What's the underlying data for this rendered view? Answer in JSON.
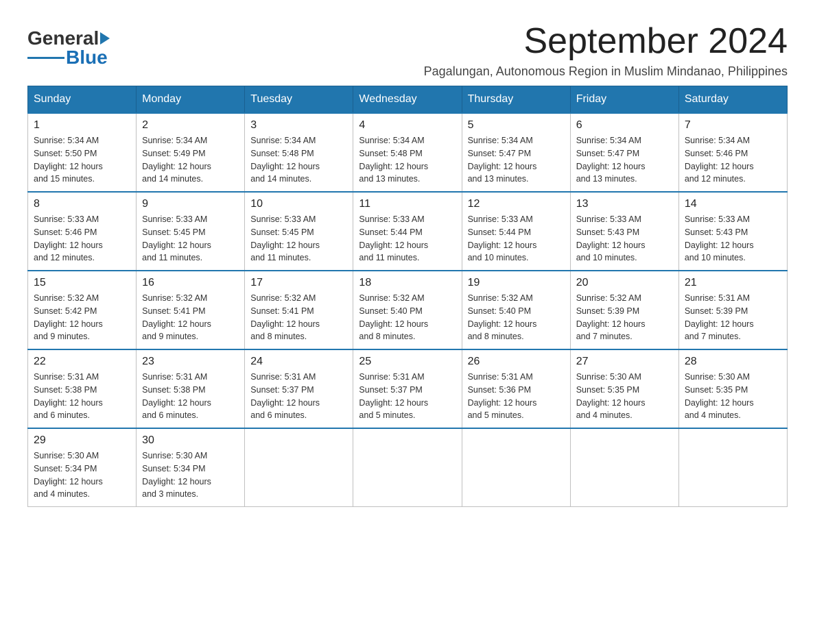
{
  "header": {
    "logo_general": "General",
    "logo_blue": "Blue",
    "month_title": "September 2024",
    "subtitle": "Pagalungan, Autonomous Region in Muslim Mindanao, Philippines"
  },
  "days_of_week": [
    "Sunday",
    "Monday",
    "Tuesday",
    "Wednesday",
    "Thursday",
    "Friday",
    "Saturday"
  ],
  "weeks": [
    [
      {
        "day": "1",
        "sunrise": "5:34 AM",
        "sunset": "5:50 PM",
        "daylight": "12 hours and 15 minutes."
      },
      {
        "day": "2",
        "sunrise": "5:34 AM",
        "sunset": "5:49 PM",
        "daylight": "12 hours and 14 minutes."
      },
      {
        "day": "3",
        "sunrise": "5:34 AM",
        "sunset": "5:48 PM",
        "daylight": "12 hours and 14 minutes."
      },
      {
        "day": "4",
        "sunrise": "5:34 AM",
        "sunset": "5:48 PM",
        "daylight": "12 hours and 13 minutes."
      },
      {
        "day": "5",
        "sunrise": "5:34 AM",
        "sunset": "5:47 PM",
        "daylight": "12 hours and 13 minutes."
      },
      {
        "day": "6",
        "sunrise": "5:34 AM",
        "sunset": "5:47 PM",
        "daylight": "12 hours and 13 minutes."
      },
      {
        "day": "7",
        "sunrise": "5:34 AM",
        "sunset": "5:46 PM",
        "daylight": "12 hours and 12 minutes."
      }
    ],
    [
      {
        "day": "8",
        "sunrise": "5:33 AM",
        "sunset": "5:46 PM",
        "daylight": "12 hours and 12 minutes."
      },
      {
        "day": "9",
        "sunrise": "5:33 AM",
        "sunset": "5:45 PM",
        "daylight": "12 hours and 11 minutes."
      },
      {
        "day": "10",
        "sunrise": "5:33 AM",
        "sunset": "5:45 PM",
        "daylight": "12 hours and 11 minutes."
      },
      {
        "day": "11",
        "sunrise": "5:33 AM",
        "sunset": "5:44 PM",
        "daylight": "12 hours and 11 minutes."
      },
      {
        "day": "12",
        "sunrise": "5:33 AM",
        "sunset": "5:44 PM",
        "daylight": "12 hours and 10 minutes."
      },
      {
        "day": "13",
        "sunrise": "5:33 AM",
        "sunset": "5:43 PM",
        "daylight": "12 hours and 10 minutes."
      },
      {
        "day": "14",
        "sunrise": "5:33 AM",
        "sunset": "5:43 PM",
        "daylight": "12 hours and 10 minutes."
      }
    ],
    [
      {
        "day": "15",
        "sunrise": "5:32 AM",
        "sunset": "5:42 PM",
        "daylight": "12 hours and 9 minutes."
      },
      {
        "day": "16",
        "sunrise": "5:32 AM",
        "sunset": "5:41 PM",
        "daylight": "12 hours and 9 minutes."
      },
      {
        "day": "17",
        "sunrise": "5:32 AM",
        "sunset": "5:41 PM",
        "daylight": "12 hours and 8 minutes."
      },
      {
        "day": "18",
        "sunrise": "5:32 AM",
        "sunset": "5:40 PM",
        "daylight": "12 hours and 8 minutes."
      },
      {
        "day": "19",
        "sunrise": "5:32 AM",
        "sunset": "5:40 PM",
        "daylight": "12 hours and 8 minutes."
      },
      {
        "day": "20",
        "sunrise": "5:32 AM",
        "sunset": "5:39 PM",
        "daylight": "12 hours and 7 minutes."
      },
      {
        "day": "21",
        "sunrise": "5:31 AM",
        "sunset": "5:39 PM",
        "daylight": "12 hours and 7 minutes."
      }
    ],
    [
      {
        "day": "22",
        "sunrise": "5:31 AM",
        "sunset": "5:38 PM",
        "daylight": "12 hours and 6 minutes."
      },
      {
        "day": "23",
        "sunrise": "5:31 AM",
        "sunset": "5:38 PM",
        "daylight": "12 hours and 6 minutes."
      },
      {
        "day": "24",
        "sunrise": "5:31 AM",
        "sunset": "5:37 PM",
        "daylight": "12 hours and 6 minutes."
      },
      {
        "day": "25",
        "sunrise": "5:31 AM",
        "sunset": "5:37 PM",
        "daylight": "12 hours and 5 minutes."
      },
      {
        "day": "26",
        "sunrise": "5:31 AM",
        "sunset": "5:36 PM",
        "daylight": "12 hours and 5 minutes."
      },
      {
        "day": "27",
        "sunrise": "5:30 AM",
        "sunset": "5:35 PM",
        "daylight": "12 hours and 4 minutes."
      },
      {
        "day": "28",
        "sunrise": "5:30 AM",
        "sunset": "5:35 PM",
        "daylight": "12 hours and 4 minutes."
      }
    ],
    [
      {
        "day": "29",
        "sunrise": "5:30 AM",
        "sunset": "5:34 PM",
        "daylight": "12 hours and 4 minutes."
      },
      {
        "day": "30",
        "sunrise": "5:30 AM",
        "sunset": "5:34 PM",
        "daylight": "12 hours and 3 minutes."
      },
      null,
      null,
      null,
      null,
      null
    ]
  ],
  "labels": {
    "sunrise": "Sunrise:",
    "sunset": "Sunset:",
    "daylight": "Daylight:"
  }
}
